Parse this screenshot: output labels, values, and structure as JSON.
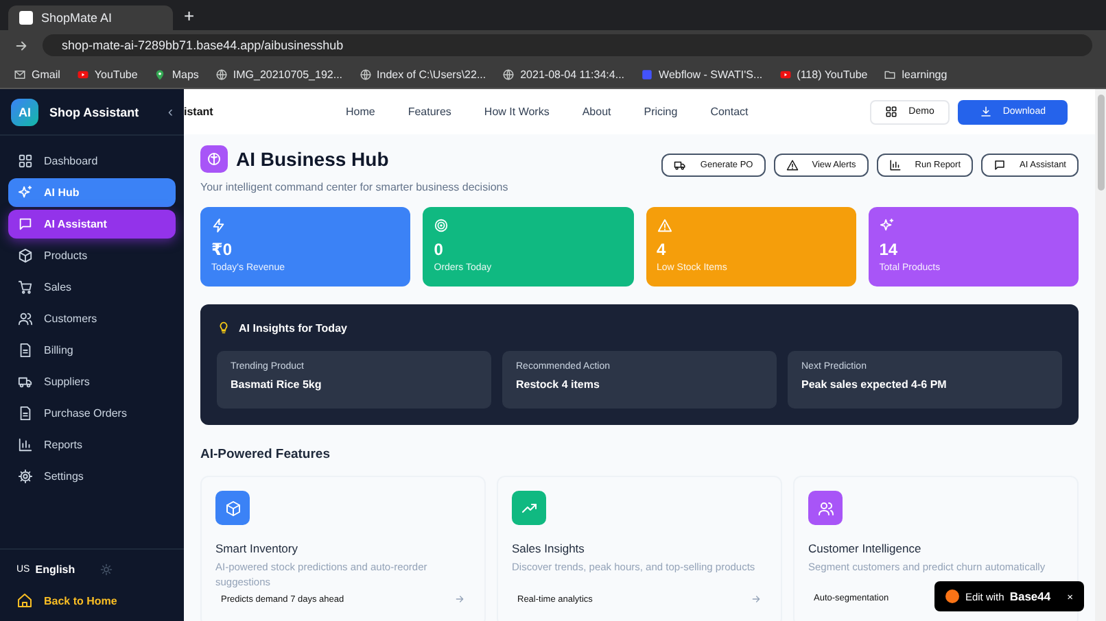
{
  "browser": {
    "tab_title": "ShopMate AI",
    "new_tab": "+",
    "url": "shop-mate-ai-7289bb71.base44.app/aibusinesshub",
    "bookmarks": [
      {
        "label": "Gmail",
        "kind": "mail"
      },
      {
        "label": "YouTube",
        "kind": "video"
      },
      {
        "label": "Maps",
        "kind": "map"
      },
      {
        "label": "IMG_20210705_192...",
        "kind": "page"
      },
      {
        "label": "Index of C:\\Users\\22...",
        "kind": "page"
      },
      {
        "label": "2021-08-04 11:34:4...",
        "kind": "page"
      },
      {
        "label": "Webflow - SWATI'S...",
        "kind": "app"
      },
      {
        "label": "(118) YouTube",
        "kind": "video"
      },
      {
        "label": "learningg",
        "kind": "folder"
      }
    ]
  },
  "sidebar": {
    "logo": "AI",
    "brand": "Shop Assistant",
    "collapse": "‹",
    "items": [
      {
        "label": "Dashboard",
        "kind": "grid",
        "highlighted": false,
        "selected": false
      },
      {
        "label": "AI Hub",
        "kind": "sparkle",
        "highlighted": false,
        "selected": true
      },
      {
        "label": "AI Assistant",
        "kind": "chat",
        "highlighted": true,
        "selected": false
      },
      {
        "label": "Products",
        "kind": "box",
        "highlighted": false,
        "selected": false
      },
      {
        "label": "Sales",
        "kind": "cart",
        "highlighted": false,
        "selected": false
      },
      {
        "label": "Customers",
        "kind": "users",
        "highlighted": false,
        "selected": false
      },
      {
        "label": "Billing",
        "kind": "doc",
        "highlighted": false,
        "selected": false
      },
      {
        "label": "Suppliers",
        "kind": "truck",
        "highlighted": false,
        "selected": false
      },
      {
        "label": "Purchase Orders",
        "kind": "doc",
        "highlighted": false,
        "selected": false
      },
      {
        "label": "Reports",
        "kind": "chart",
        "highlighted": false,
        "selected": false
      },
      {
        "label": "Settings",
        "kind": "gear",
        "highlighted": false,
        "selected": false
      }
    ],
    "language_code": "US",
    "language": "English",
    "back": "Back to Home"
  },
  "topnav": {
    "brand_partial": "istant",
    "links": [
      "Home",
      "Features",
      "How It Works",
      "About",
      "Pricing",
      "Contact"
    ],
    "demo": "Demo",
    "download": "Download"
  },
  "hub": {
    "title": "AI Business Hub",
    "subtitle": "Your intelligent command center for smarter business decisions",
    "actions": [
      {
        "label": "Generate PO",
        "kind": "truck"
      },
      {
        "label": "View Alerts",
        "kind": "alert"
      },
      {
        "label": "Run Report",
        "kind": "chart"
      },
      {
        "label": "AI Assistant",
        "kind": "chat"
      }
    ],
    "stats": [
      {
        "value": "₹0",
        "label": "Today's Revenue",
        "kind": "bolt",
        "color": "#3b82f6"
      },
      {
        "value": "0",
        "label": "Orders Today",
        "kind": "target",
        "color": "#10b981"
      },
      {
        "value": "4",
        "label": "Low Stock Items",
        "kind": "alert",
        "color": "#f59e0b"
      },
      {
        "value": "14",
        "label": "Total Products",
        "kind": "sparkle",
        "color": "#a855f7"
      }
    ],
    "insights": {
      "title": "AI Insights for Today",
      "items": [
        {
          "label": "Trending Product",
          "value": "Basmati Rice 5kg"
        },
        {
          "label": "Recommended Action",
          "value": "Restock 4 items"
        },
        {
          "label": "Next Prediction",
          "value": "Peak sales expected 4-6 PM"
        }
      ]
    },
    "features_title": "AI-Powered Features",
    "features": [
      {
        "title": "Smart Inventory",
        "description": "AI-powered stock predictions and auto-reorder suggestions",
        "tag": "Predicts demand 7 days ahead",
        "kind": "box",
        "color": "#3b82f6"
      },
      {
        "title": "Sales Insights",
        "description": "Discover trends, peak hours, and top-selling products",
        "tag": "Real-time analytics",
        "kind": "trend",
        "color": "#10b981"
      },
      {
        "title": "Customer Intelligence",
        "description": "Segment customers and predict churn automatically",
        "tag": "Auto-segmentation",
        "kind": "users",
        "color": "#a855f7"
      }
    ]
  },
  "badge": {
    "prefix": "Edit with",
    "brand": "Base44",
    "close": "×"
  }
}
